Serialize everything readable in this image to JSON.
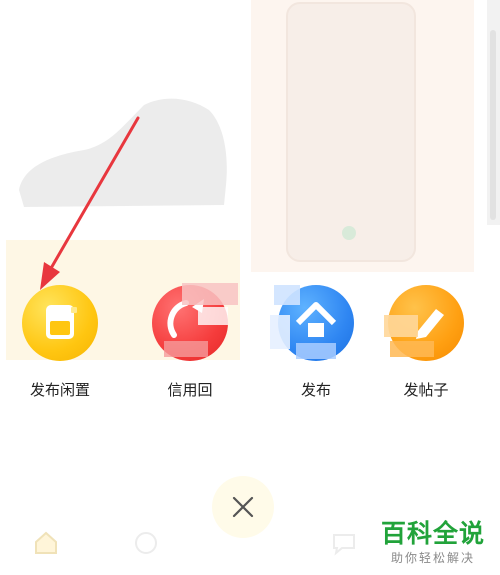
{
  "actions": [
    {
      "label": "发布闲置",
      "icon": "post-item-icon",
      "color": "#ffc611"
    },
    {
      "label": "信用回",
      "icon": "credit-recycle-icon",
      "color": "#f53c3c"
    },
    {
      "label": "发布",
      "icon": "publish-house-icon",
      "color": "#2f86f2"
    },
    {
      "label": "发帖子",
      "icon": "edit-post-icon",
      "color": "#ffa012"
    }
  ],
  "close": {
    "icon": "close-icon"
  },
  "watermark": {
    "brand": "百科全说",
    "slogan": "助你轻松解决"
  },
  "colors": {
    "annotation_arrow": "#e8373e",
    "brand_green": "#21a33a"
  }
}
